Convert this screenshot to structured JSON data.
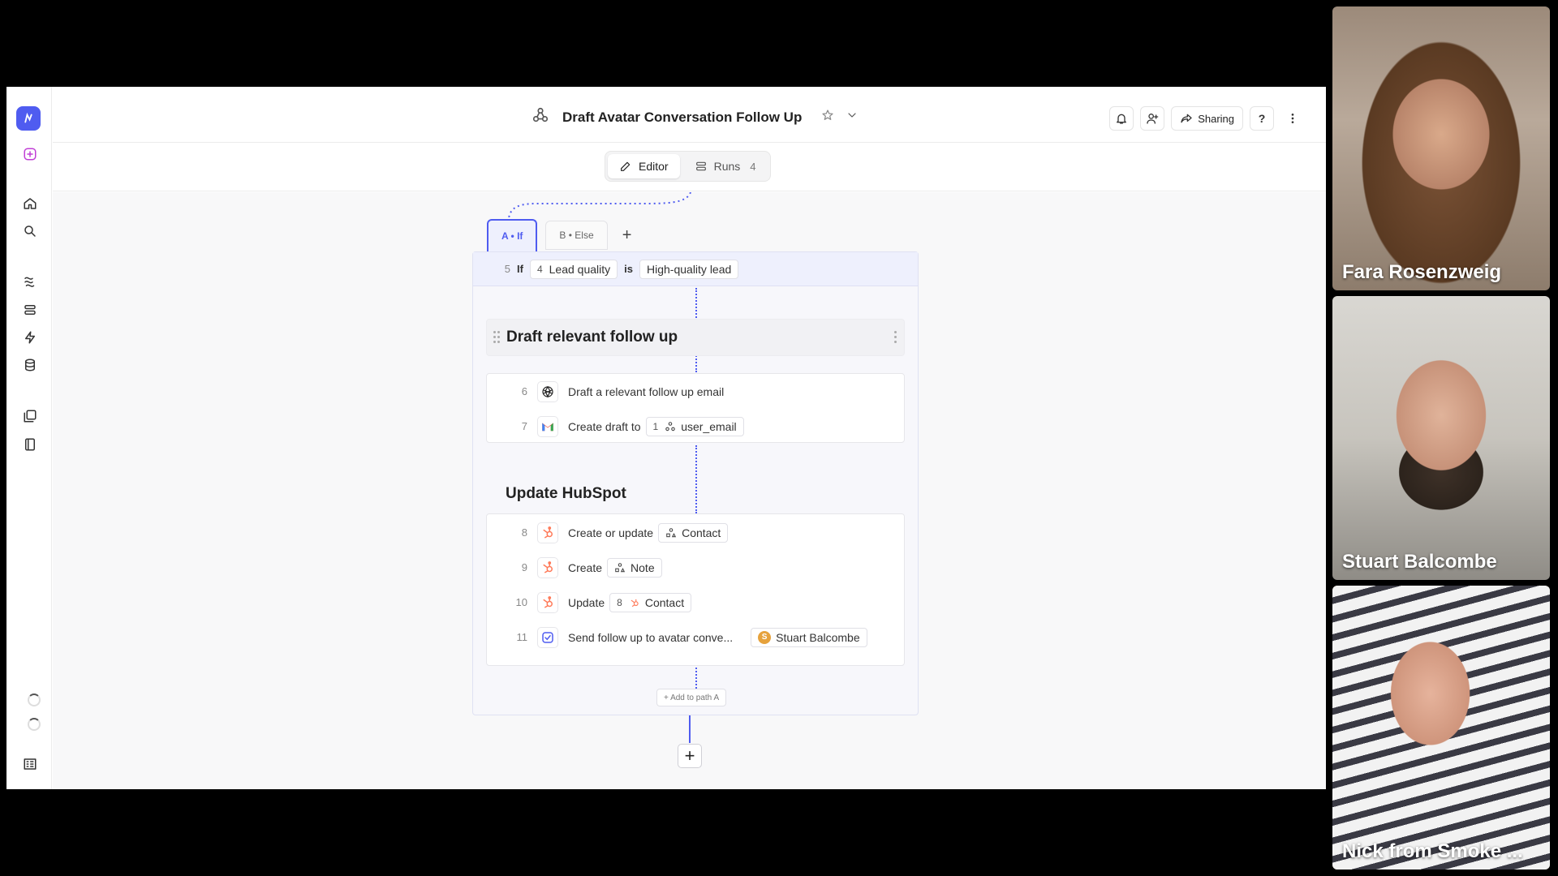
{
  "workflow": {
    "title": "Draft Avatar Conversation Follow Up"
  },
  "topbar": {
    "sharing_label": "Sharing",
    "help_label": "?"
  },
  "modes": {
    "editor_label": "Editor",
    "runs_label": "Runs",
    "runs_count": "4"
  },
  "branches": {
    "a_label": "A • If",
    "b_label": "B • Else",
    "add_label": "+"
  },
  "condition": {
    "step": "5",
    "keyword_if": "If",
    "ref_num": "4",
    "field": "Lead quality",
    "keyword_is": "is",
    "value": "High-quality lead"
  },
  "groups": [
    {
      "title": "Draft relevant follow up"
    },
    {
      "title": "Update HubSpot"
    }
  ],
  "steps": [
    {
      "num": "6",
      "text": "Draft a relevant follow up email"
    },
    {
      "num": "7",
      "text": "Create draft to",
      "chip_num": "1",
      "chip": "user_email"
    },
    {
      "num": "8",
      "text": "Create or update",
      "chip": "Contact"
    },
    {
      "num": "9",
      "text": "Create",
      "chip": "Note"
    },
    {
      "num": "10",
      "text": "Update",
      "chip_num": "8",
      "chip": "Contact"
    },
    {
      "num": "11",
      "text": "Send follow up to avatar conve...",
      "chip_initial": "S",
      "chip": "Stuart Balcombe"
    }
  ],
  "add_path_label": "+ Add to path A",
  "add_step_label": "+",
  "participants": [
    {
      "name": "Fara Rosenzweig"
    },
    {
      "name": "Stuart Balcombe"
    },
    {
      "name": "Nick from Smoke ..."
    }
  ],
  "colors": {
    "accent": "#4f5cf0",
    "hubspot": "#ff7a59",
    "gmail_red": "#ea4335"
  }
}
